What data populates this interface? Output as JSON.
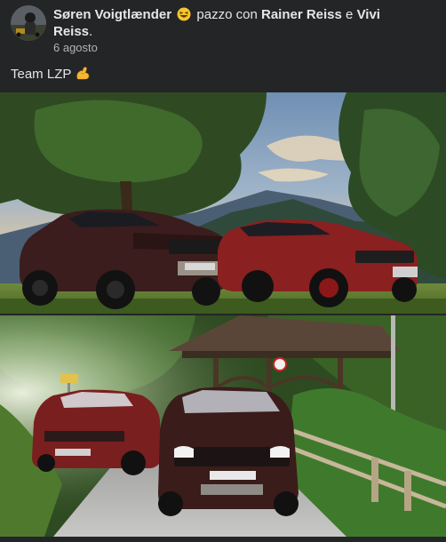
{
  "post": {
    "author": "Søren Voigtlænder",
    "feeling_emoji": "grinning-face-with-tongue-icon",
    "feeling_text": "pazzo con",
    "tagged_1": "Rainer Reiss",
    "conjunction": "e",
    "tagged_2": "Vivi Reiss",
    "tagged_2_suffix": ".",
    "timestamp": "6 agosto",
    "caption": "Team LZP",
    "caption_emoji": "flexed-biceps-icon"
  },
  "photos": [
    {
      "name": "two-suvs-mountain-meadow-photo"
    },
    {
      "name": "two-suvs-forest-road-photo"
    }
  ],
  "colors": {
    "background": "#242526",
    "text_primary": "#e4e6eb",
    "text_secondary": "#b0b3b8"
  }
}
